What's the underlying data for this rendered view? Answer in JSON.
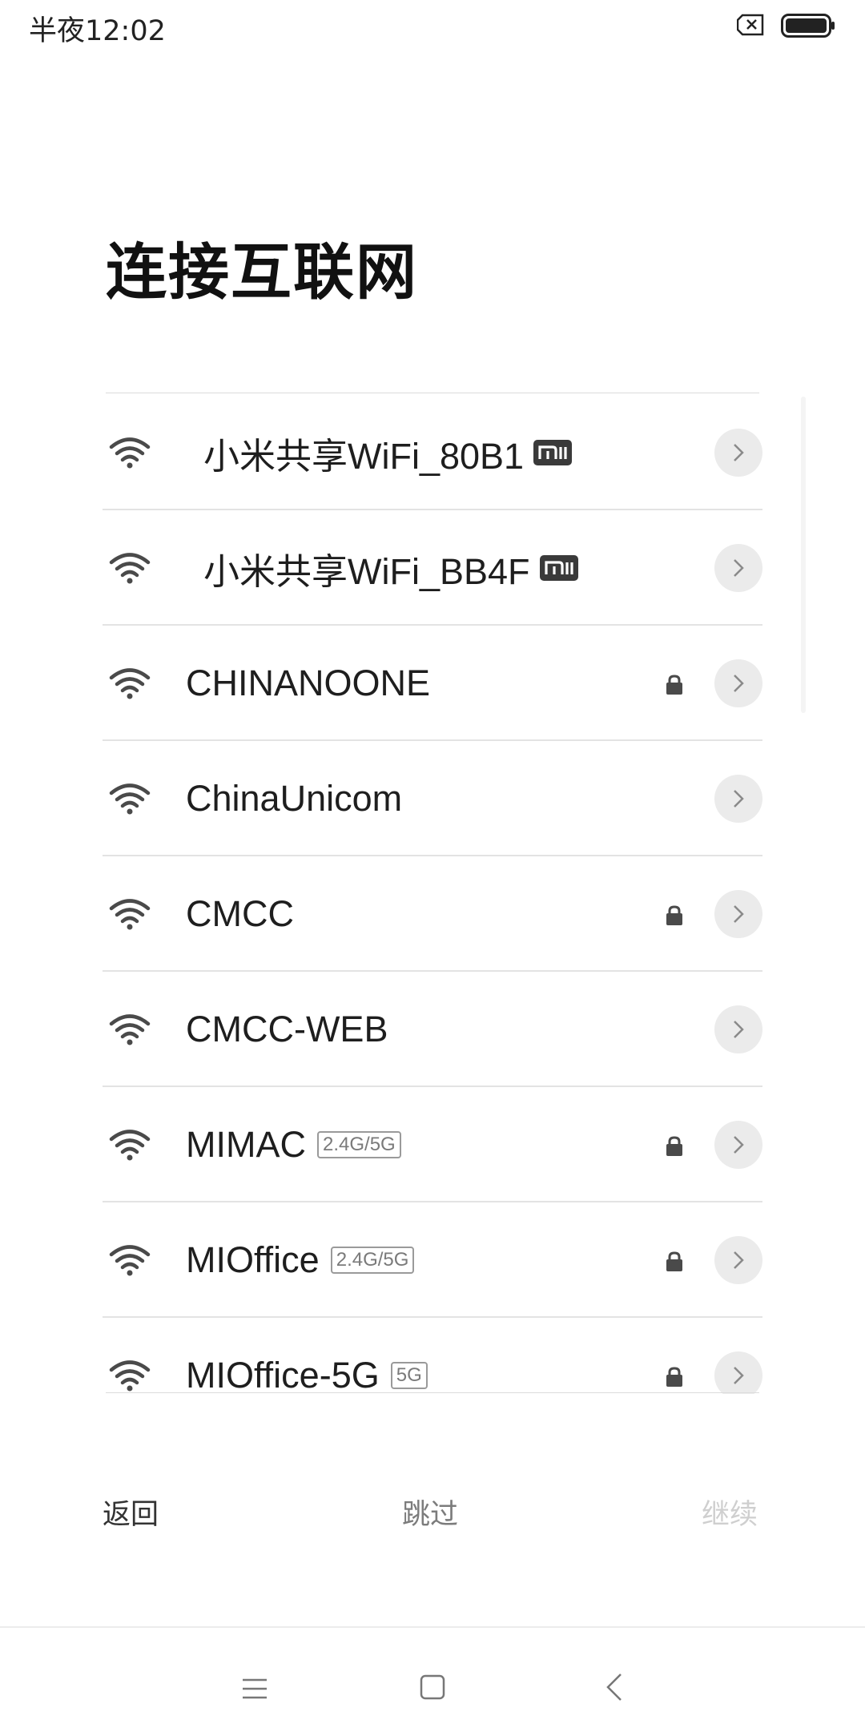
{
  "status_bar": {
    "time": "半夜12:02",
    "sim_icon": "no-sim-icon",
    "battery_icon": "battery-full-icon"
  },
  "page": {
    "title": "连接互联网"
  },
  "wifi_list": [
    {
      "ssid": "小米共享WiFi_80B1",
      "mi_badge": true,
      "band": "",
      "locked": false
    },
    {
      "ssid": "小米共享WiFi_BB4F",
      "mi_badge": true,
      "band": "",
      "locked": false
    },
    {
      "ssid": "CHINANOONE",
      "mi_badge": false,
      "band": "",
      "locked": true
    },
    {
      "ssid": "ChinaUnicom",
      "mi_badge": false,
      "band": "",
      "locked": false
    },
    {
      "ssid": "CMCC",
      "mi_badge": false,
      "band": "",
      "locked": true
    },
    {
      "ssid": "CMCC-WEB",
      "mi_badge": false,
      "band": "",
      "locked": false
    },
    {
      "ssid": "MIMAC",
      "mi_badge": false,
      "band": "2.4G/5G",
      "locked": true
    },
    {
      "ssid": "MIOffice",
      "mi_badge": false,
      "band": "2.4G/5G",
      "locked": true
    },
    {
      "ssid": "MIOffice-5G",
      "mi_badge": false,
      "band": "5G",
      "locked": true
    }
  ],
  "footer": {
    "back_label": "返回",
    "skip_label": "跳过",
    "next_label": "继续"
  },
  "nav_bar": {
    "menu_icon": "menu-icon",
    "home_icon": "home-icon",
    "back_icon": "back-arrow-icon"
  },
  "colors": {
    "text": "#1e1e1e",
    "icon": "#4a4a4a",
    "disabled": "#cfcfcf",
    "divider": "#e3e3e3"
  }
}
